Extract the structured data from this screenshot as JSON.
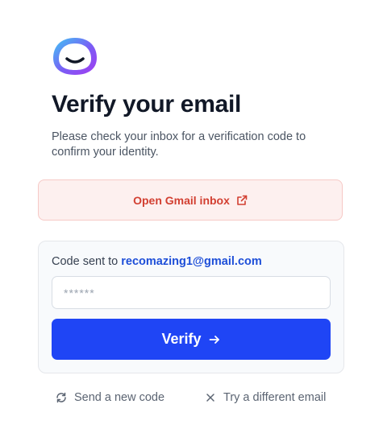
{
  "header": {
    "title": "Verify your email",
    "subtitle": "Please check your inbox for a verification code to confirm your identity.",
    "logo_icon": "smiling-face-logo-icon"
  },
  "gmail": {
    "label": "Open Gmail inbox",
    "icon": "external-link-icon"
  },
  "code_card": {
    "sent_prefix": "Code sent to",
    "email": "recomazing1@gmail.com",
    "input_value": "",
    "input_placeholder": "******",
    "verify_label": "Verify",
    "verify_icon": "arrow-right-icon"
  },
  "footer": {
    "send_new_code_label": "Send a new code",
    "send_new_code_icon": "refresh-icon",
    "different_email_label": "Try a different email",
    "different_email_icon": "close-icon"
  },
  "colors": {
    "primary": "#1f45f5",
    "gmail_text": "#d23f31",
    "gmail_bg": "#fdf0ef",
    "link_email": "#1d4ed8",
    "logo_gradient_start": "#3ec7f4",
    "logo_gradient_end": "#a23cf0"
  }
}
